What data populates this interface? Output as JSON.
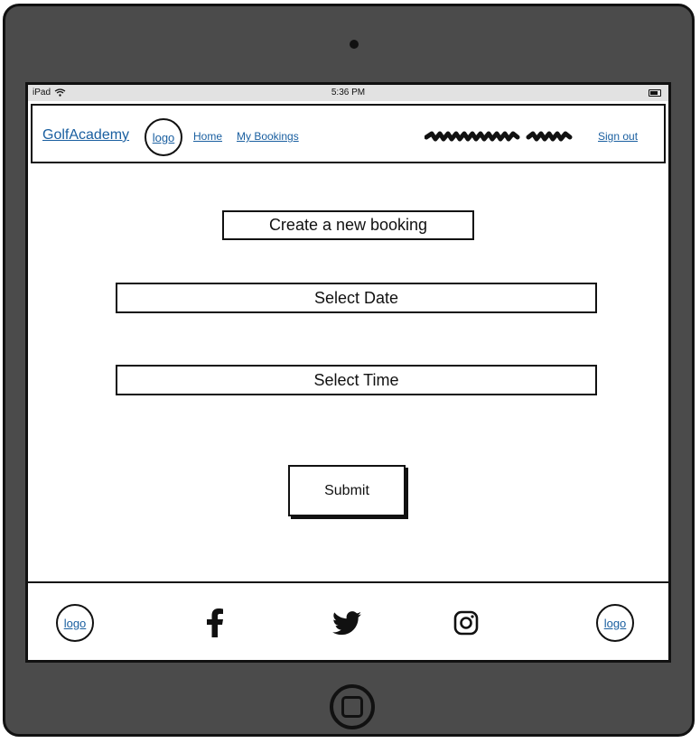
{
  "status_bar": {
    "carrier": "iPad",
    "time": "5:36 PM"
  },
  "nav": {
    "brand": "GolfAcademy",
    "logo": "logo",
    "home": "Home",
    "my_bookings": "My Bookings",
    "sign_out": "Sign out"
  },
  "main": {
    "heading": "Create a new booking",
    "select_date": "Select Date",
    "select_time": "Select Time",
    "submit": "Submit"
  },
  "footer": {
    "logo_left": "logo",
    "logo_right": "logo",
    "icons": [
      "facebook-icon",
      "twitter-icon",
      "instagram-icon"
    ]
  },
  "colors": {
    "link": "#1a5fa0",
    "device": "#4b4b4b",
    "status_bar": "#e2e2e2"
  }
}
